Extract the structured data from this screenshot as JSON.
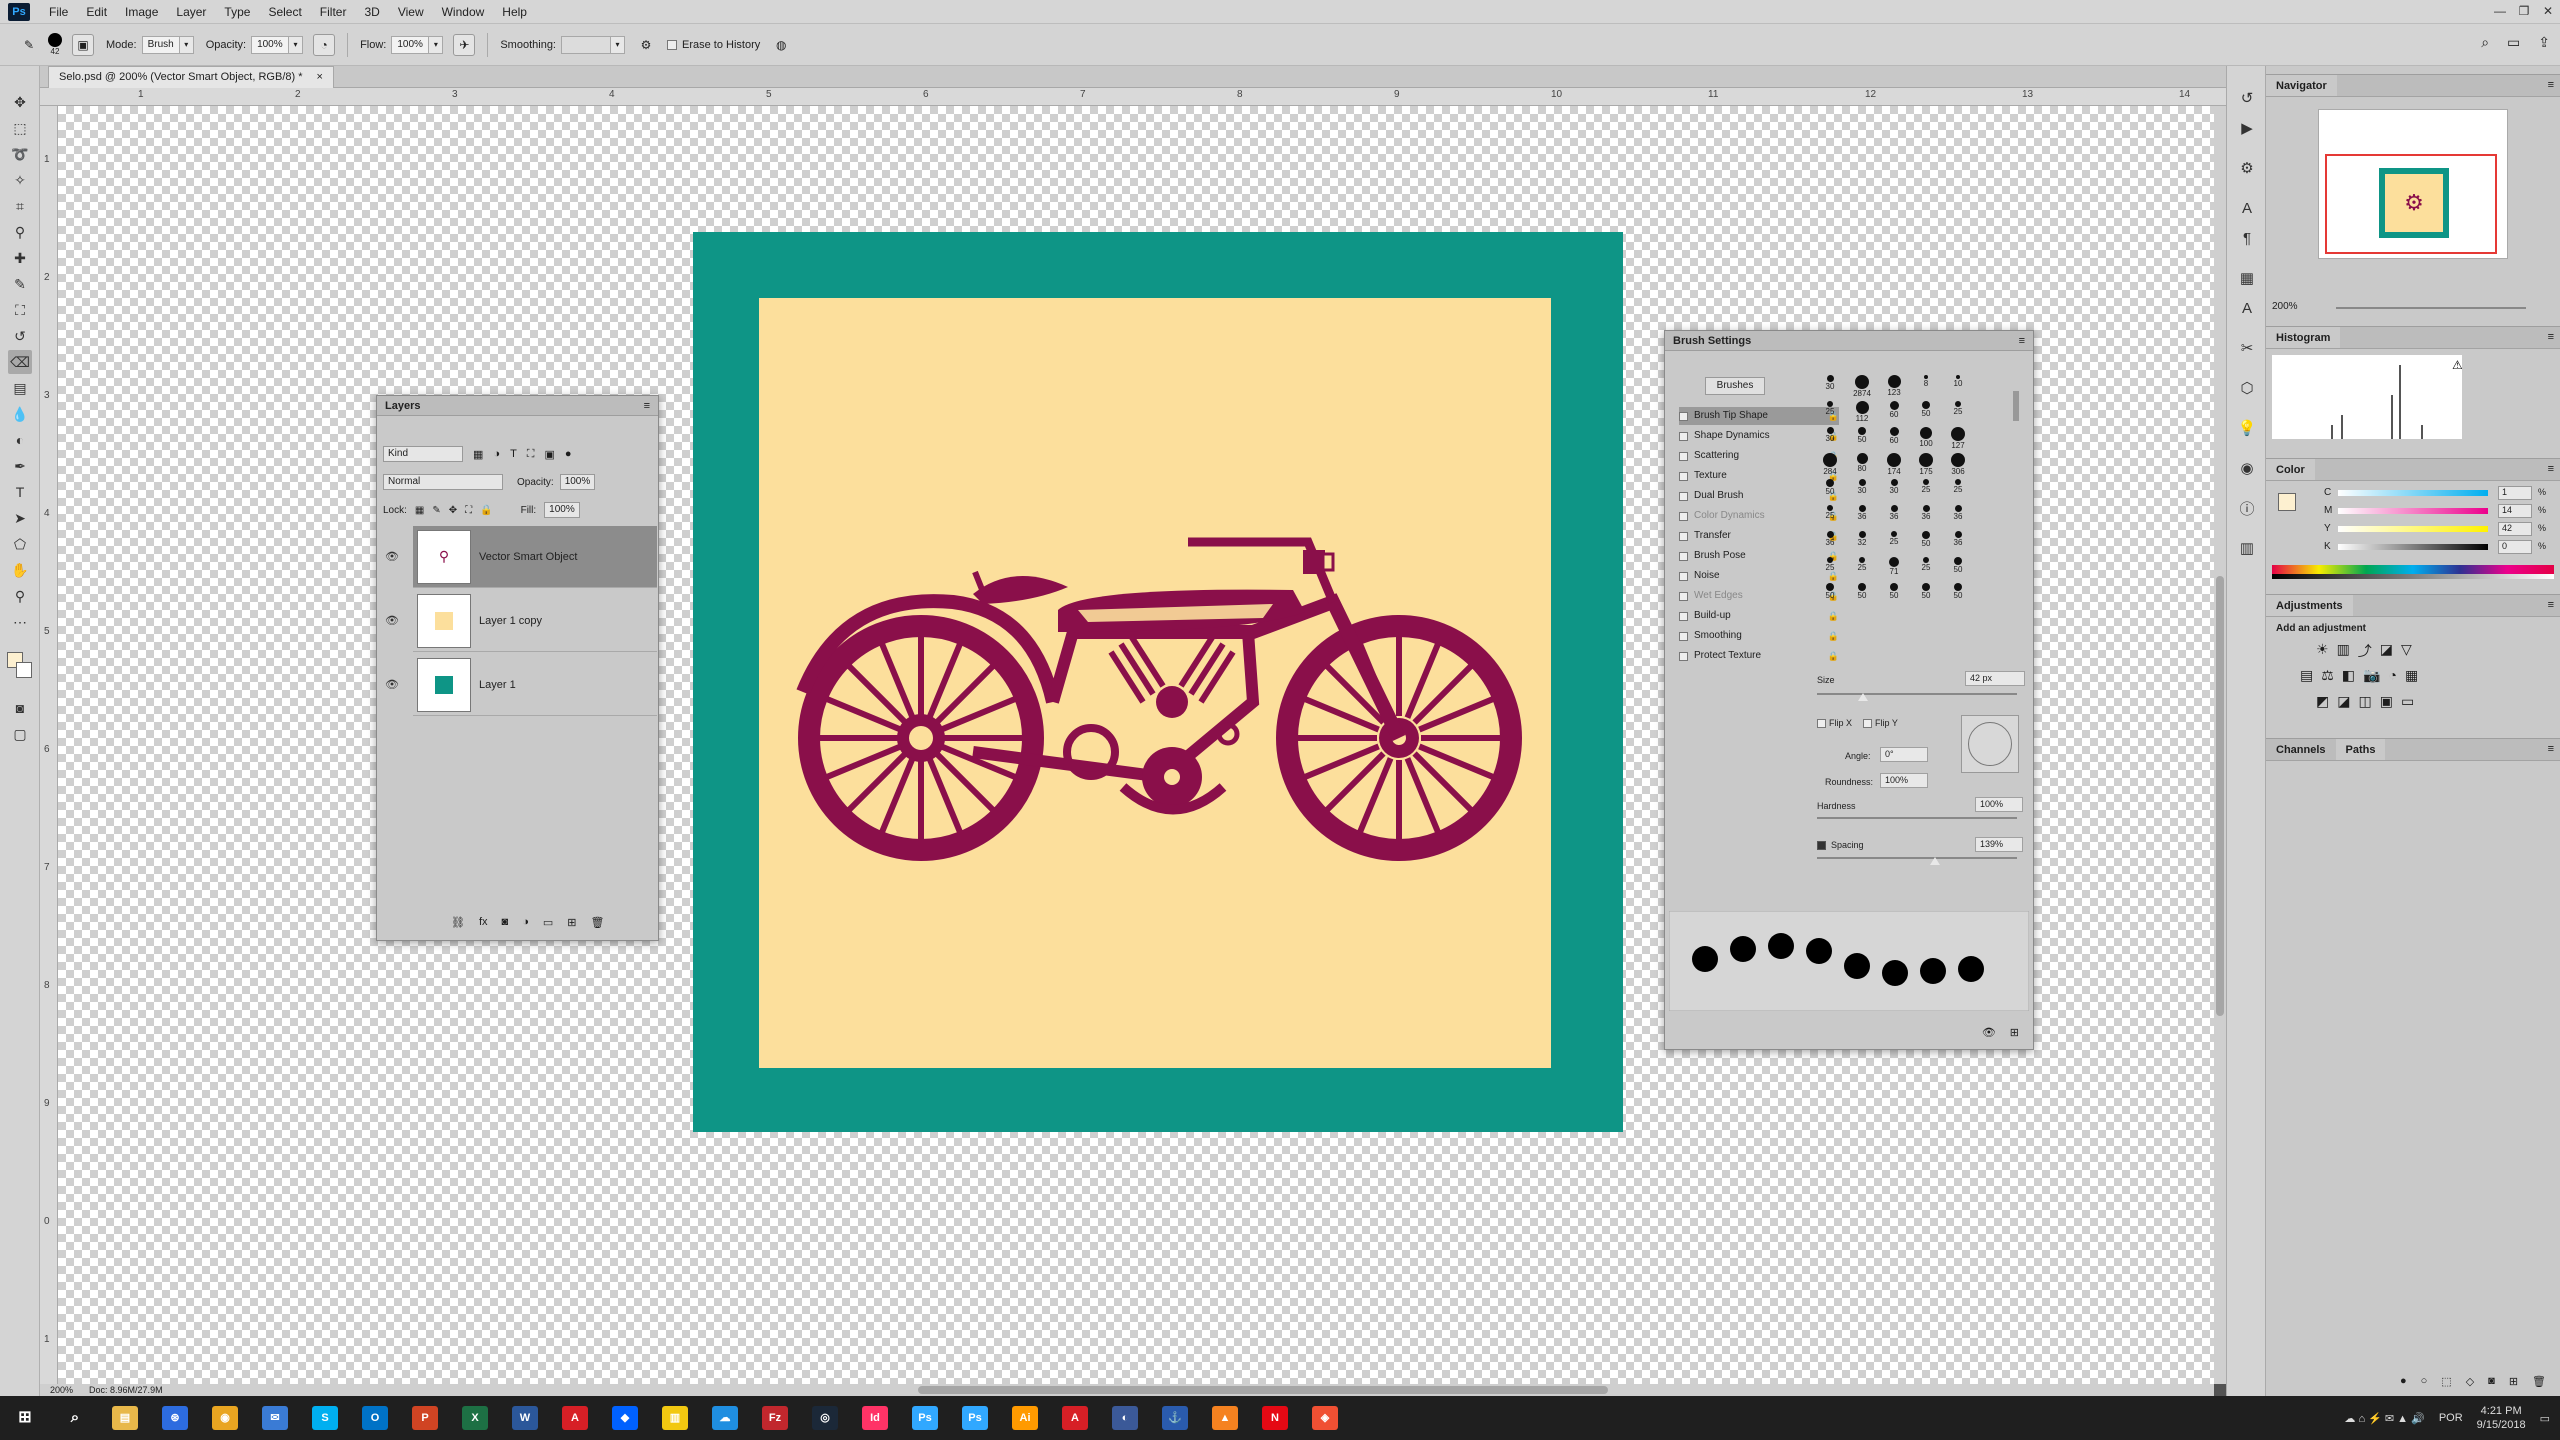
{
  "menubar": {
    "logo": "Ps",
    "items": [
      "File",
      "Edit",
      "Image",
      "Layer",
      "Type",
      "Select",
      "Filter",
      "3D",
      "View",
      "Window",
      "Help"
    ]
  },
  "options": {
    "brush_size": "42",
    "mode_label": "Mode:",
    "mode_value": "Brush",
    "opacity_label": "Opacity:",
    "opacity_value": "100%",
    "flow_label": "Flow:",
    "flow_value": "100%",
    "smoothing_label": "Smoothing:",
    "smoothing_value": "",
    "erase_history_label": "Erase to History"
  },
  "document_tab": {
    "title": "Selo.psd @ 200% (Vector Smart Object, RGB/8) *",
    "close": "×"
  },
  "ruler": {
    "top_labels": [
      "1",
      "2",
      "3",
      "4",
      "5",
      "6",
      "7",
      "8",
      "9",
      "10",
      "11",
      "12",
      "13",
      "14"
    ],
    "left_labels": [
      "1",
      "2",
      "3",
      "4",
      "5",
      "6",
      "7",
      "8",
      "9",
      "0",
      "1"
    ]
  },
  "status": {
    "zoom": "200%",
    "doc": "Doc: 8.96M/27.9M"
  },
  "colors": {
    "stamp_border": "#0e9586",
    "stamp_fill": "#fcdf9c",
    "motorcycle": "#8a0f4a",
    "foreground": "#fdf0d0",
    "background": "#ffffff"
  },
  "layers_panel": {
    "title": "Layers",
    "filter_kind": "Kind",
    "blend_mode": "Normal",
    "opacity_label": "Opacity:",
    "opacity_value": "100%",
    "lock_label": "Lock:",
    "fill_label": "Fill:",
    "fill_value": "100%",
    "layers": [
      {
        "name": "Vector Smart Object",
        "selected": true
      },
      {
        "name": "Layer 1 copy",
        "selected": false
      },
      {
        "name": "Layer 1",
        "selected": false
      }
    ],
    "footer_fx": "fx"
  },
  "brush_settings": {
    "title": "Brush Settings",
    "brushes_button": "Brushes",
    "options": [
      {
        "label": "Brush Tip Shape",
        "active": true,
        "dim": false
      },
      {
        "label": "Shape Dynamics",
        "active": false,
        "dim": false
      },
      {
        "label": "Scattering",
        "active": false,
        "dim": false
      },
      {
        "label": "Texture",
        "active": false,
        "dim": false
      },
      {
        "label": "Dual Brush",
        "active": false,
        "dim": false
      },
      {
        "label": "Color Dynamics",
        "active": false,
        "dim": true
      },
      {
        "label": "Transfer",
        "active": false,
        "dim": false
      },
      {
        "label": "Brush Pose",
        "active": false,
        "dim": false
      },
      {
        "label": "Noise",
        "active": false,
        "dim": false
      },
      {
        "label": "Wet Edges",
        "active": false,
        "dim": true
      },
      {
        "label": "Build-up",
        "active": false,
        "dim": false
      },
      {
        "label": "Smoothing",
        "active": false,
        "dim": false
      },
      {
        "label": "Protect Texture",
        "active": false,
        "dim": false
      }
    ],
    "tip_sizes": [
      [
        "30",
        "2874",
        "123",
        "8",
        "10"
      ],
      [
        "25",
        "112",
        "60",
        "50",
        "25"
      ],
      [
        "30",
        "50",
        "60",
        "100",
        "127"
      ],
      [
        "284",
        "80",
        "174",
        "175",
        "306"
      ],
      [
        "50",
        "30",
        "30",
        "25",
        "25"
      ],
      [
        "25",
        "36",
        "36",
        "36",
        "36"
      ],
      [
        "36",
        "32",
        "25",
        "50",
        "36"
      ],
      [
        "25",
        "25",
        "71",
        "25",
        "50"
      ],
      [
        "50",
        "50",
        "50",
        "50",
        "50"
      ]
    ],
    "size_label": "Size",
    "size_value": "42 px",
    "flip_x": "Flip X",
    "flip_y": "Flip Y",
    "angle_label": "Angle:",
    "angle_value": "0°",
    "roundness_label": "Roundness:",
    "roundness_value": "100%",
    "hardness_label": "Hardness",
    "hardness_value": "100%",
    "spacing_label": "Spacing",
    "spacing_value": "139%"
  },
  "navigator": {
    "title": "Navigator",
    "zoom": "200%"
  },
  "histogram": {
    "title": "Histogram"
  },
  "color_panel": {
    "title": "Color",
    "channels": [
      {
        "label": "C",
        "value": "1"
      },
      {
        "label": "M",
        "value": "14"
      },
      {
        "label": "Y",
        "value": "42"
      },
      {
        "label": "K",
        "value": "0"
      }
    ],
    "unit": "%"
  },
  "adjustments": {
    "title": "Adjustments",
    "subtitle": "Add an adjustment"
  },
  "channels_panel": {
    "tabs": [
      "Channels",
      "Paths"
    ]
  },
  "taskbar": {
    "apps": [
      "Files",
      "Store",
      "Chrome",
      "Mail",
      "Skype",
      "Outlook",
      "PowerPoint",
      "Excel",
      "Word",
      "Acrobat",
      "Dropbox",
      "Notes",
      "Cloud",
      "FileZilla",
      "Steam",
      "InDesign",
      "Photoshop",
      "Photoshop",
      "Illustrator",
      "Reader",
      "Media",
      "Torrent",
      "VLC",
      "Netflix",
      "Git"
    ],
    "lang": "POR",
    "time": "4:21 PM",
    "date": "9/15/2018"
  }
}
